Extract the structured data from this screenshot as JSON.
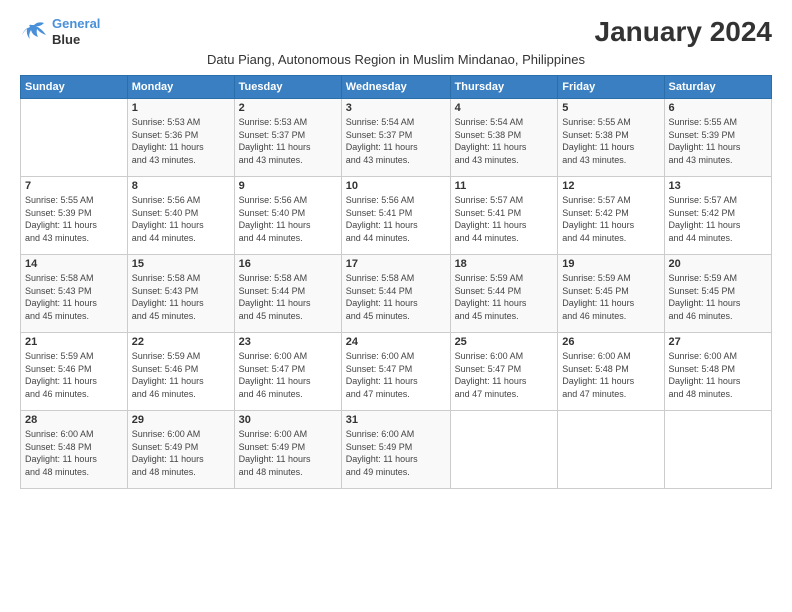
{
  "header": {
    "logo_line1": "General",
    "logo_line2": "Blue",
    "month_title": "January 2024",
    "subtitle": "Datu Piang, Autonomous Region in Muslim Mindanao, Philippines"
  },
  "days_of_week": [
    "Sunday",
    "Monday",
    "Tuesday",
    "Wednesday",
    "Thursday",
    "Friday",
    "Saturday"
  ],
  "weeks": [
    [
      {
        "num": "",
        "info": ""
      },
      {
        "num": "1",
        "info": "Sunrise: 5:53 AM\nSunset: 5:36 PM\nDaylight: 11 hours\nand 43 minutes."
      },
      {
        "num": "2",
        "info": "Sunrise: 5:53 AM\nSunset: 5:37 PM\nDaylight: 11 hours\nand 43 minutes."
      },
      {
        "num": "3",
        "info": "Sunrise: 5:54 AM\nSunset: 5:37 PM\nDaylight: 11 hours\nand 43 minutes."
      },
      {
        "num": "4",
        "info": "Sunrise: 5:54 AM\nSunset: 5:38 PM\nDaylight: 11 hours\nand 43 minutes."
      },
      {
        "num": "5",
        "info": "Sunrise: 5:55 AM\nSunset: 5:38 PM\nDaylight: 11 hours\nand 43 minutes."
      },
      {
        "num": "6",
        "info": "Sunrise: 5:55 AM\nSunset: 5:39 PM\nDaylight: 11 hours\nand 43 minutes."
      }
    ],
    [
      {
        "num": "7",
        "info": "Sunrise: 5:55 AM\nSunset: 5:39 PM\nDaylight: 11 hours\nand 43 minutes."
      },
      {
        "num": "8",
        "info": "Sunrise: 5:56 AM\nSunset: 5:40 PM\nDaylight: 11 hours\nand 44 minutes."
      },
      {
        "num": "9",
        "info": "Sunrise: 5:56 AM\nSunset: 5:40 PM\nDaylight: 11 hours\nand 44 minutes."
      },
      {
        "num": "10",
        "info": "Sunrise: 5:56 AM\nSunset: 5:41 PM\nDaylight: 11 hours\nand 44 minutes."
      },
      {
        "num": "11",
        "info": "Sunrise: 5:57 AM\nSunset: 5:41 PM\nDaylight: 11 hours\nand 44 minutes."
      },
      {
        "num": "12",
        "info": "Sunrise: 5:57 AM\nSunset: 5:42 PM\nDaylight: 11 hours\nand 44 minutes."
      },
      {
        "num": "13",
        "info": "Sunrise: 5:57 AM\nSunset: 5:42 PM\nDaylight: 11 hours\nand 44 minutes."
      }
    ],
    [
      {
        "num": "14",
        "info": "Sunrise: 5:58 AM\nSunset: 5:43 PM\nDaylight: 11 hours\nand 45 minutes."
      },
      {
        "num": "15",
        "info": "Sunrise: 5:58 AM\nSunset: 5:43 PM\nDaylight: 11 hours\nand 45 minutes."
      },
      {
        "num": "16",
        "info": "Sunrise: 5:58 AM\nSunset: 5:44 PM\nDaylight: 11 hours\nand 45 minutes."
      },
      {
        "num": "17",
        "info": "Sunrise: 5:58 AM\nSunset: 5:44 PM\nDaylight: 11 hours\nand 45 minutes."
      },
      {
        "num": "18",
        "info": "Sunrise: 5:59 AM\nSunset: 5:44 PM\nDaylight: 11 hours\nand 45 minutes."
      },
      {
        "num": "19",
        "info": "Sunrise: 5:59 AM\nSunset: 5:45 PM\nDaylight: 11 hours\nand 46 minutes."
      },
      {
        "num": "20",
        "info": "Sunrise: 5:59 AM\nSunset: 5:45 PM\nDaylight: 11 hours\nand 46 minutes."
      }
    ],
    [
      {
        "num": "21",
        "info": "Sunrise: 5:59 AM\nSunset: 5:46 PM\nDaylight: 11 hours\nand 46 minutes."
      },
      {
        "num": "22",
        "info": "Sunrise: 5:59 AM\nSunset: 5:46 PM\nDaylight: 11 hours\nand 46 minutes."
      },
      {
        "num": "23",
        "info": "Sunrise: 6:00 AM\nSunset: 5:47 PM\nDaylight: 11 hours\nand 46 minutes."
      },
      {
        "num": "24",
        "info": "Sunrise: 6:00 AM\nSunset: 5:47 PM\nDaylight: 11 hours\nand 47 minutes."
      },
      {
        "num": "25",
        "info": "Sunrise: 6:00 AM\nSunset: 5:47 PM\nDaylight: 11 hours\nand 47 minutes."
      },
      {
        "num": "26",
        "info": "Sunrise: 6:00 AM\nSunset: 5:48 PM\nDaylight: 11 hours\nand 47 minutes."
      },
      {
        "num": "27",
        "info": "Sunrise: 6:00 AM\nSunset: 5:48 PM\nDaylight: 11 hours\nand 48 minutes."
      }
    ],
    [
      {
        "num": "28",
        "info": "Sunrise: 6:00 AM\nSunset: 5:48 PM\nDaylight: 11 hours\nand 48 minutes."
      },
      {
        "num": "29",
        "info": "Sunrise: 6:00 AM\nSunset: 5:49 PM\nDaylight: 11 hours\nand 48 minutes."
      },
      {
        "num": "30",
        "info": "Sunrise: 6:00 AM\nSunset: 5:49 PM\nDaylight: 11 hours\nand 48 minutes."
      },
      {
        "num": "31",
        "info": "Sunrise: 6:00 AM\nSunset: 5:49 PM\nDaylight: 11 hours\nand 49 minutes."
      },
      {
        "num": "",
        "info": ""
      },
      {
        "num": "",
        "info": ""
      },
      {
        "num": "",
        "info": ""
      }
    ]
  ]
}
